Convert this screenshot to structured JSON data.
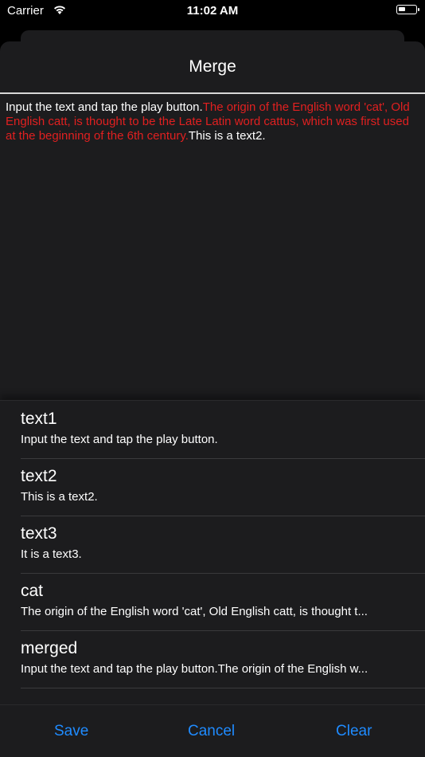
{
  "status": {
    "carrier": "Carrier",
    "time": "11:02 AM"
  },
  "sheet": {
    "title": "Merge"
  },
  "editor": {
    "segments": [
      {
        "text": "Input the text and tap the play button.",
        "color": "#ffffff"
      },
      {
        "text": "The origin of the English word 'cat', Old English catt, is thought to be the Late Latin word cattus, which was first used at the beginning of the 6th century.",
        "color": "#e02020"
      },
      {
        "text": "This is a text2.",
        "color": "#ffffff"
      }
    ]
  },
  "items": [
    {
      "title": "text1",
      "subtitle": "Input the text and tap the play button."
    },
    {
      "title": "text2",
      "subtitle": "This is a text2."
    },
    {
      "title": "text3",
      "subtitle": "It is a text3."
    },
    {
      "title": "cat",
      "subtitle": "The origin of the English word 'cat', Old English catt, is thought t..."
    },
    {
      "title": "merged",
      "subtitle": "Input the text and tap the play button.The origin of the English w..."
    }
  ],
  "toolbar": {
    "save": "Save",
    "cancel": "Cancel",
    "clear": "Clear"
  },
  "colors": {
    "accent": "#1f8bff",
    "highlight": "#e02020",
    "background": "#1c1c1e"
  }
}
